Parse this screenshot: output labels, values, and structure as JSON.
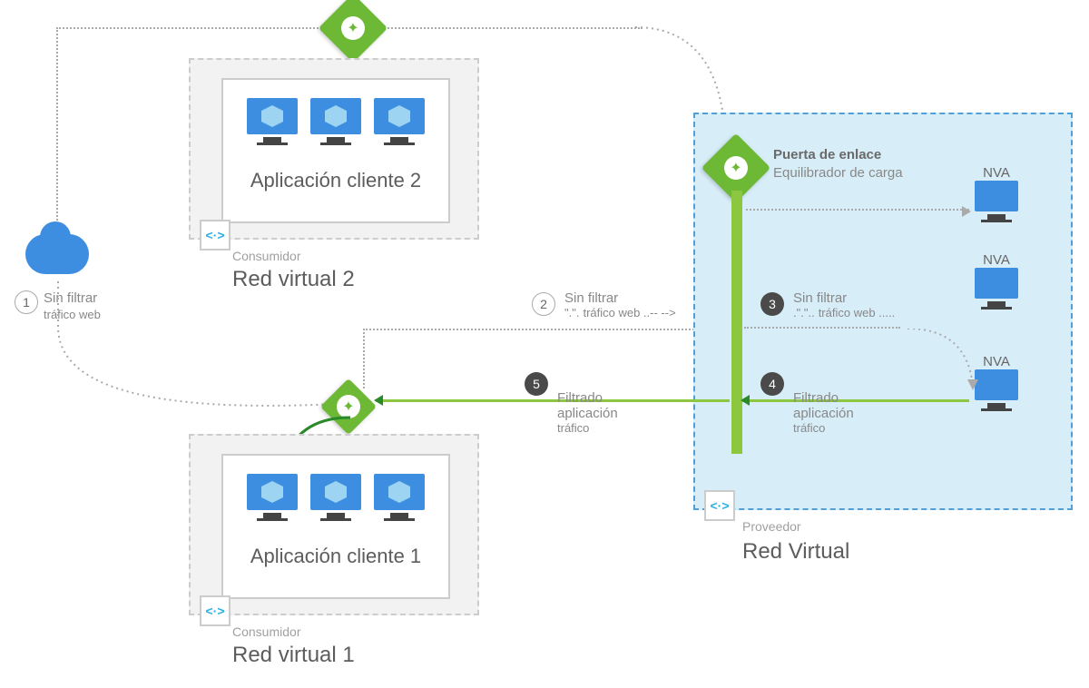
{
  "vnet2": {
    "role": "Consumidor",
    "title": "Red virtual 2",
    "app": "Aplicación cliente 2"
  },
  "vnet1": {
    "role": "Consumidor",
    "title": "Red virtual 1",
    "app": "Aplicación cliente 1"
  },
  "provider": {
    "role": "Proveedor",
    "title": "Red Virtual",
    "gateway_title": "Puerta de enlace",
    "gateway_sub": "Equilibrador de carga"
  },
  "nva": "NVA",
  "steps": {
    "s1": {
      "num": "1",
      "title": "Sin filtrar",
      "sub": "tráfico web"
    },
    "s2": {
      "num": "2",
      "title": "Sin filtrar",
      "pre": "\".\".",
      "sub": "tráfico web ..-- -->"
    },
    "s3": {
      "num": "3",
      "title": "Sin filtrar",
      "pre": ".\".\"..",
      "sub": "tráfico web ....."
    },
    "s4": {
      "num": "4",
      "title": "Filtrado",
      "l2": "aplicación",
      "l3": "tráfico"
    },
    "s5": {
      "num": "5",
      "title": "Filtrado",
      "l2": "aplicación",
      "l3": "tráfico"
    }
  }
}
